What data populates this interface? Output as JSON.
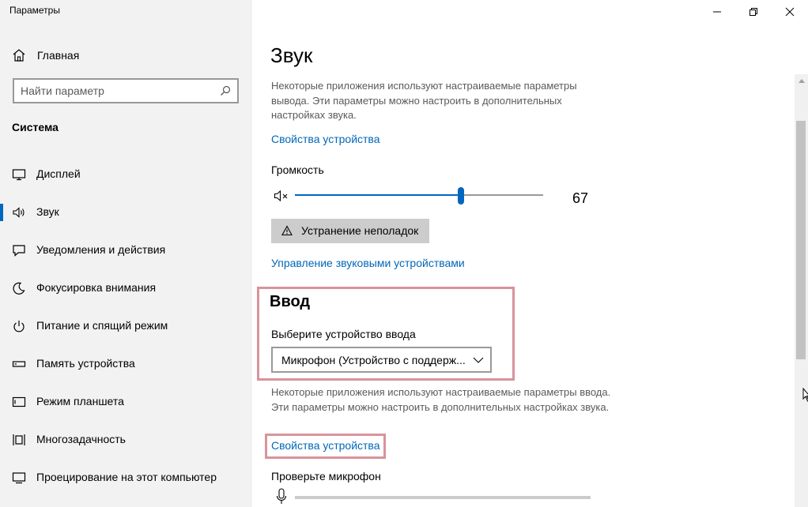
{
  "window": {
    "title": "Параметры"
  },
  "sidebar": {
    "home_label": "Главная",
    "search_placeholder": "Найти параметр",
    "section_title": "Система",
    "items": [
      {
        "label": "Дисплей",
        "icon": "display-icon"
      },
      {
        "label": "Звук",
        "icon": "speaker-icon",
        "active": true
      },
      {
        "label": "Уведомления и действия",
        "icon": "notification-icon"
      },
      {
        "label": "Фокусировка внимания",
        "icon": "moon-icon"
      },
      {
        "label": "Питание и спящий режим",
        "icon": "power-icon"
      },
      {
        "label": "Память устройства",
        "icon": "storage-icon"
      },
      {
        "label": "Режим планшета",
        "icon": "tablet-icon"
      },
      {
        "label": "Многозадачность",
        "icon": "multitask-icon"
      },
      {
        "label": "Проецирование на этот компьютер",
        "icon": "projection-icon"
      }
    ]
  },
  "main": {
    "title": "Звук",
    "output_paragraph": "Некоторые приложения используют настраиваемые параметры вывода. Эти параметры можно настроить в дополнительных настройках звука.",
    "output_device_props_link": "Свойства устройства",
    "volume_label": "Громкость",
    "volume_value": "67",
    "volume_level": 67,
    "troubleshoot_button": "Устранение неполадок",
    "manage_devices_link": "Управление звуковыми устройствами",
    "input_title": "Ввод",
    "input_device_label": "Выберите устройство ввода",
    "input_device_value": "Микрофон (Устройство с поддерж...",
    "input_paragraph": "Некоторые приложения используют настраиваемые параметры ввода. Эти параметры можно настроить в дополнительных настройках звука.",
    "input_device_props_link": "Свойства устройства",
    "test_mic_label": "Проверьте микрофон"
  },
  "colors": {
    "accent": "#0067c0",
    "link": "#0067b8",
    "highlight": "#d9939b",
    "sidebar_bg": "#f2f2f2"
  }
}
